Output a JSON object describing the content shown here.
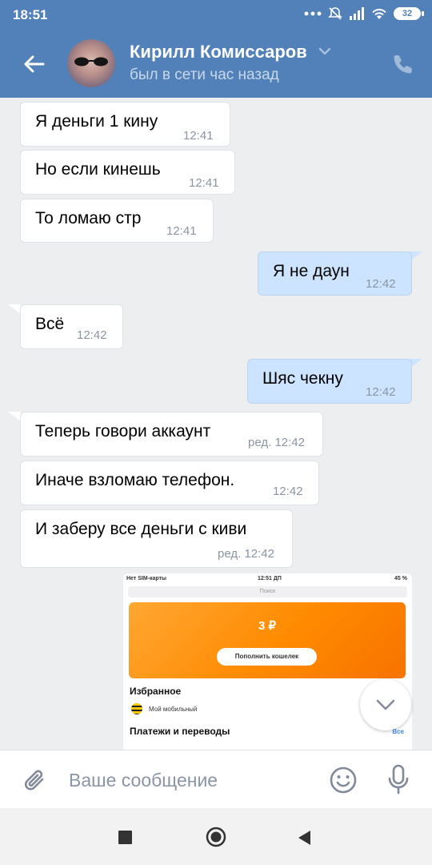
{
  "status_bar": {
    "time": "18:51",
    "battery": "32"
  },
  "header": {
    "name": "Кирилл Комиссаров",
    "status": "был в сети час назад"
  },
  "messages": [
    {
      "dir": "in",
      "text": "Я деньги 1 кину",
      "time": "12:41"
    },
    {
      "dir": "in",
      "text": "Но если кинешь",
      "time": "12:41"
    },
    {
      "dir": "in",
      "text": "То ломаю стр",
      "time": "12:41"
    },
    {
      "dir": "out",
      "text": "Я не даун",
      "time": "12:42"
    },
    {
      "dir": "in",
      "text": "Всё",
      "time": "12:42"
    },
    {
      "dir": "out",
      "text": "Шяс чекну",
      "time": "12:42"
    },
    {
      "dir": "in",
      "text": "Теперь говори аккаунт",
      "time": "ред. 12:42"
    },
    {
      "dir": "in",
      "text": "Иначе взломаю телефон.",
      "time": "12:42"
    },
    {
      "dir": "in",
      "text": "И заберу все деньги с киви",
      "time": "ред. 12:42"
    }
  ],
  "image_message": {
    "status_left": "Нет SIM-карты",
    "status_time": "12:51 ДП",
    "status_battery": "45 %",
    "search": "Поиск",
    "balance": "3 ₽",
    "topup_button": "Пополнить кошелек",
    "favorites_title": "Избранное",
    "favorite_item": "Мой мобильный",
    "payments_title": "Платежи и переводы",
    "all_link": "Все"
  },
  "input": {
    "placeholder": "Ваше сообщение"
  },
  "colors": {
    "header": "#5181b8",
    "outgoing_bubble": "#cce4ff",
    "incoming_bubble": "#ffffff",
    "chat_bg": "#edeef0",
    "qiwi_orange": "#ff8c00"
  }
}
